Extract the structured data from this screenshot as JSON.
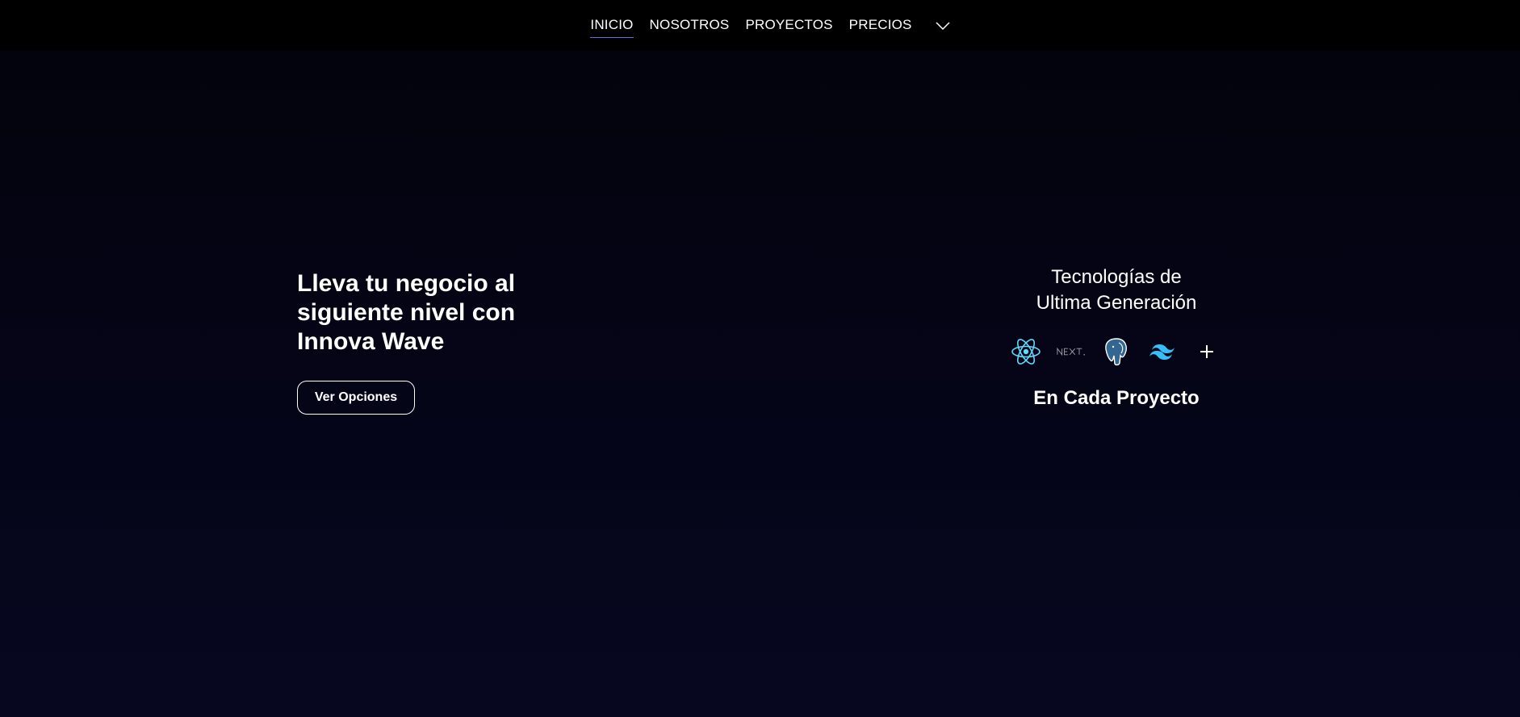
{
  "nav": {
    "items": [
      {
        "label": "INICIO",
        "active": true
      },
      {
        "label": "NOSOTROS",
        "active": false
      },
      {
        "label": "PROYECTOS",
        "active": false
      },
      {
        "label": "PRECIOS",
        "active": false
      }
    ],
    "more_icon": "chevron-down-icon"
  },
  "hero": {
    "title_line1": "Lleva tu negocio al",
    "title_line2": "siguiente nivel con",
    "title_line3": "Innova Wave",
    "cta_label": "Ver Opciones"
  },
  "tech": {
    "heading_line1": "Tecnologías de",
    "heading_line2": "Ultima Generación",
    "icons": [
      "react-icon",
      "nextjs-icon",
      "postgresql-icon",
      "tailwind-icon",
      "plus-icon"
    ],
    "footer": "En Cada Proyecto"
  },
  "colors": {
    "background": "#04040e",
    "nav_background": "#000000",
    "active_underline": "#6b6bd8",
    "react": "#61dafb",
    "tailwind": "#38bdf8",
    "postgres": "#336791"
  }
}
